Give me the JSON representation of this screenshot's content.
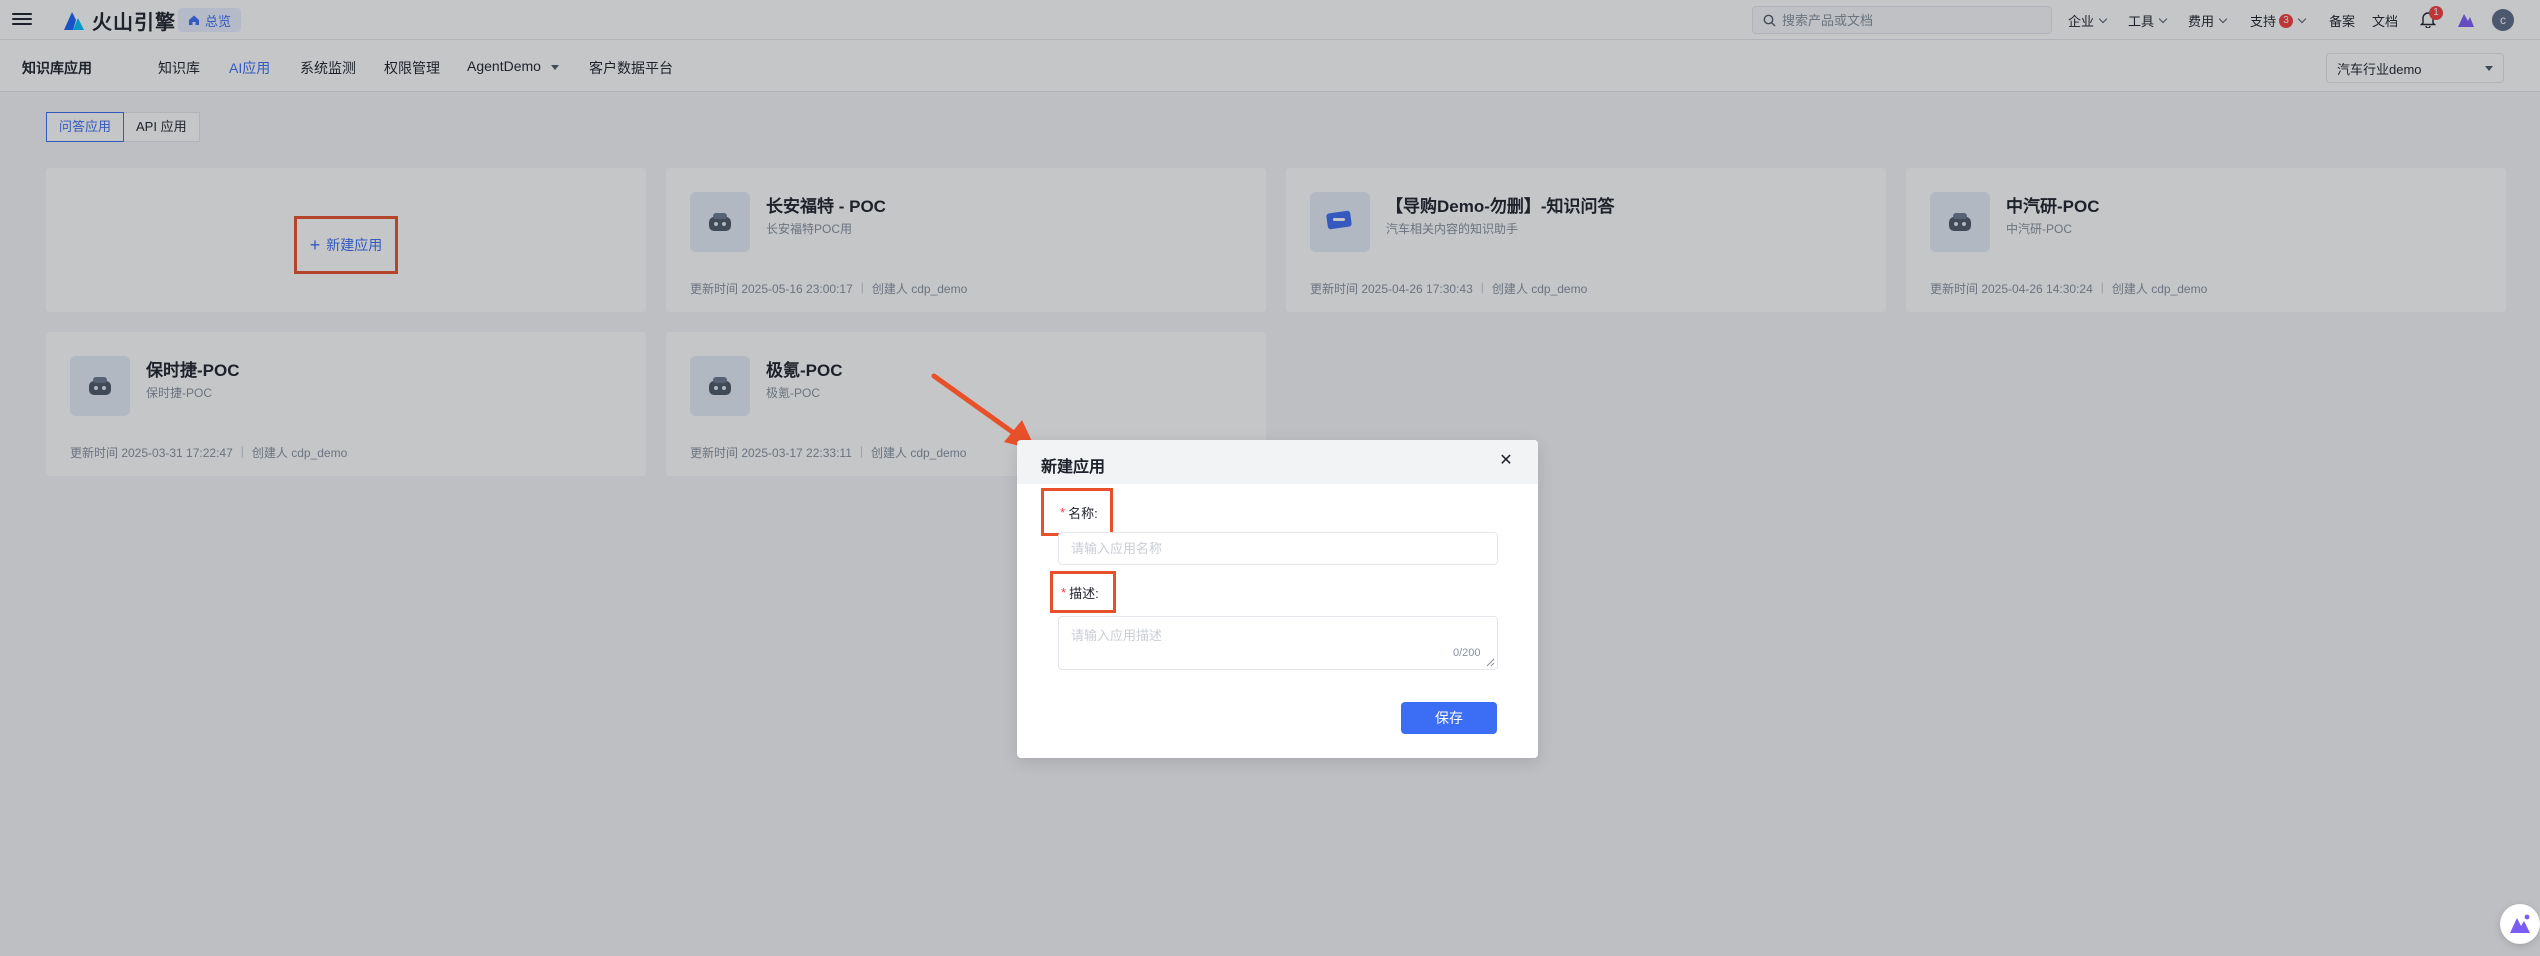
{
  "topbar": {
    "brand": "火山引擎",
    "overview": "总览",
    "search_placeholder": "搜索产品或文档",
    "nav": {
      "enterprise": "企业",
      "tools": "工具",
      "cost": "费用",
      "support": "支持",
      "support_badge": "3",
      "filing": "备案",
      "docs": "文档"
    },
    "notification_badge": "1",
    "avatar_letter": "c"
  },
  "subnav": {
    "title": "知识库应用",
    "items": [
      "知识库",
      "AI应用",
      "系统监测",
      "权限管理",
      "AgentDemo",
      "客户数据平台"
    ],
    "active": "AI应用",
    "industry_select": "汽车行业demo"
  },
  "tabs": [
    "问答应用",
    "API 应用"
  ],
  "new_app_label": "新建应用",
  "cards": [
    {
      "title": "长安福特 - POC",
      "desc": "长安福特POC用",
      "updated": "更新时间 2025-05-16 23:00:17",
      "creator": "创建人 cdp_demo"
    },
    {
      "title": "【导购Demo-勿删】-知识问答",
      "desc": "汽车相关内容的知识助手",
      "updated": "更新时间 2025-04-26 17:30:43",
      "creator": "创建人 cdp_demo"
    },
    {
      "title": "中汽研-POC",
      "desc": "中汽研-POC",
      "updated": "更新时间 2025-04-26 14:30:24",
      "creator": "创建人 cdp_demo"
    },
    {
      "title": "保时捷-POC",
      "desc": "保时捷-POC",
      "updated": "更新时间 2025-03-31 17:22:47",
      "creator": "创建人 cdp_demo"
    },
    {
      "title": "极氪-POC",
      "desc": "极氪-POC",
      "updated": "更新时间 2025-03-17 22:33:11",
      "creator": "创建人 cdp_demo"
    }
  ],
  "modal": {
    "title": "新建应用",
    "name_label": "名称:",
    "name_placeholder": "请输入应用名称",
    "name_value": "",
    "desc_label": "描述:",
    "desc_placeholder": "请输入应用描述",
    "desc_value": "",
    "char_count": "0/200",
    "save": "保存"
  },
  "colors": {
    "accent": "#3c6ef5",
    "highlight": "#e8502a",
    "required": "#f53f3f"
  }
}
